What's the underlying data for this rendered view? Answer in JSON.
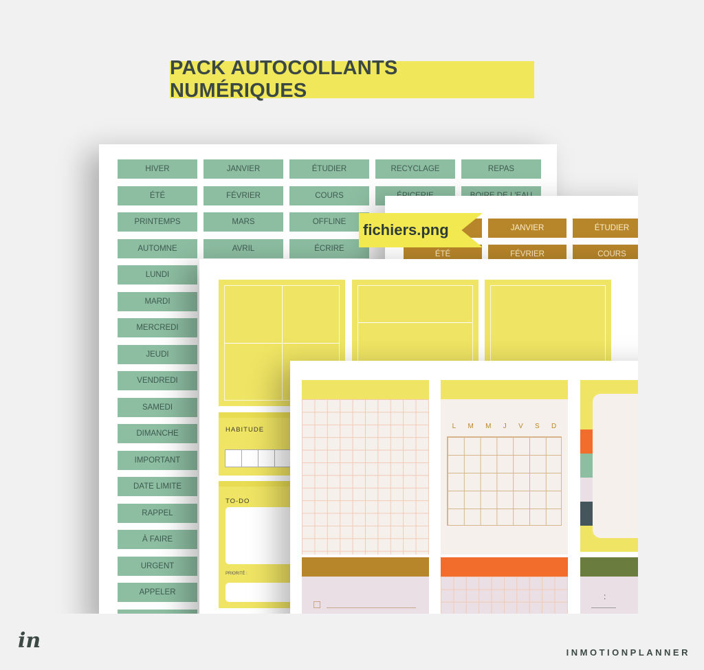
{
  "title": "PACK AUTOCOLLANTS NUMÉRIQUES",
  "ribbon": "fichiers.png",
  "brand": "INMOTIONPLANNER",
  "logo": "in",
  "colors": {
    "green": "#8dbea2",
    "brown": "#b8862a",
    "yellow": "#efe463",
    "orange": "#f26d2b",
    "olive": "#6b7d3e",
    "pink": "#ebdfe6",
    "slate": "#44555c"
  },
  "green_sheet": {
    "columns": [
      [
        "HIVER",
        "ÉTÉ",
        "PRINTEMPS",
        "AUTOMNE",
        "LUNDI",
        "MARDI",
        "MERCREDI",
        "JEUDI",
        "VENDREDI",
        "SAMEDI",
        "DIMANCHE",
        "IMPORTANT",
        "DATE LIMITE",
        "RAPPEL",
        "À FAIRE",
        "URGENT",
        "APPELER",
        ""
      ],
      [
        "JANVIER",
        "FÉVRIER",
        "MARS",
        "AVRIL"
      ],
      [
        "ÉTUDIER",
        "COURS",
        "OFFLINE",
        "ÉCRIRE"
      ],
      [
        "RECYCLAGE",
        "ÉPICERIE"
      ],
      [
        "REPAS",
        "BOIRE DE L'EAU"
      ]
    ]
  },
  "brown_sheet": {
    "rows": [
      [
        "",
        "JANVIER",
        "ÉTUDIER"
      ],
      [
        "ÉTÉ",
        "FÉVRIER",
        "COURS"
      ]
    ]
  },
  "yellow_sheet": {
    "habit_label": "HABITUDE",
    "todo_label": "TO-DO",
    "priority_label": "PRIORITÉ :"
  },
  "planner_sheet": {
    "weekdays": [
      "L",
      "M",
      "M",
      "J",
      "V",
      "S",
      "D"
    ],
    "time_sep": ":"
  }
}
